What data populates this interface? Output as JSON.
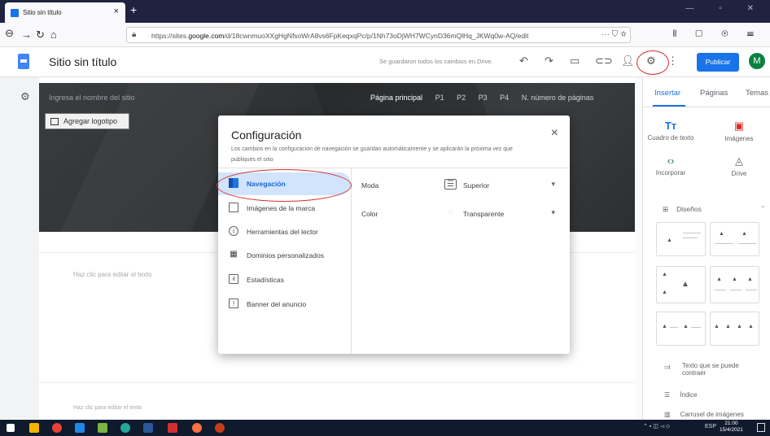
{
  "browser": {
    "tab_title": "Sitio sin título",
    "tab_close": "×",
    "new_tab": "+",
    "url_host": "https://sites.",
    "url_domain": "google.com",
    "url_path": "/d/18cwnmuoXXgHgNfsoWrA8vs6FpKeqxqPc/p/1Nh73oDjWH7WCynD36mQlHq_JKWq0w-AQ/edit",
    "url_more": "··· ⛉ ☆"
  },
  "app": {
    "site_title": "Sitio sin título",
    "saved_status": "Se guardaron todos los cambios en Drive.",
    "publish_label": "Publicar",
    "avatar_letter": "M"
  },
  "canvas": {
    "site_name_placeholder": "Ingresa el nombre del sitio",
    "add_logo_label": "Agregar logotipo",
    "page_nav": [
      "Página principal",
      "P1",
      "P2",
      "P3",
      "P4",
      "N. número de páginas"
    ],
    "body_text_1": "Haz clic para editar el texto",
    "body_text_2": "Haz clic para editar el texto"
  },
  "right_panel": {
    "tabs": [
      "Insertar",
      "Páginas",
      "Temas"
    ],
    "items": [
      {
        "label": "Cuadro de texto",
        "icon": "text-box-icon",
        "glyph": "Tт"
      },
      {
        "label": "Imágenes",
        "icon": "image-icon",
        "glyph": "▣"
      },
      {
        "label": "Incorporar",
        "icon": "embed-icon",
        "glyph": "‹›"
      },
      {
        "label": "Drive",
        "icon": "drive-icon",
        "glyph": "◬"
      }
    ],
    "layouts_label": "Diseños",
    "collapsible_label": "Texto que se puede contraer",
    "toc_label": "Índice",
    "carousel_label": "Carrusel de imágenes"
  },
  "dialog": {
    "title": "Configuración",
    "description": "Los cambios en la configuración de navegación se guardan automáticamente y se aplicarán la próxima vez que publiques el sitio",
    "close": "×",
    "menu": [
      {
        "label": "Navegación",
        "icon": "navigation-icon",
        "selected": true
      },
      {
        "label": "Imágenes de la marca",
        "icon": "brand-images-icon",
        "selected": false
      },
      {
        "label": "Herramientas del lector",
        "icon": "info-icon",
        "selected": false
      },
      {
        "label": "Dominios personalizados",
        "icon": "domain-icon",
        "selected": false
      },
      {
        "label": "Estadísticas",
        "icon": "analytics-icon",
        "selected": false
      },
      {
        "label": "Banner del anuncio",
        "icon": "banner-icon",
        "selected": false
      }
    ],
    "settings": [
      {
        "key": "Moda",
        "value": "Superior",
        "icon": "top-menu-icon"
      },
      {
        "key": "Color",
        "value": "Transparente",
        "icon": "transparent-icon"
      }
    ]
  },
  "taskbar": {
    "language": "ESP",
    "time": "21:00",
    "date": "15/4/2021"
  },
  "colors": {
    "accent": "#1a73e8",
    "annotation": "#d32f2f",
    "selected_bg": "#d2e3fc",
    "avatar": "#0b8043"
  }
}
